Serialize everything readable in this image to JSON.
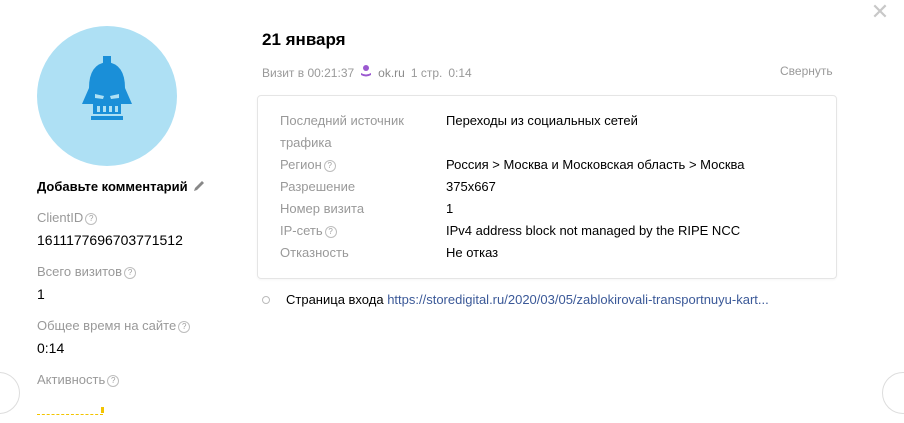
{
  "close": {
    "icon": "close-icon"
  },
  "sidebar": {
    "avatar_icon": "user-mask-icon",
    "comment_label": "Добавьте комментарий",
    "edit_icon": "pencil-icon",
    "client_id_label": "ClientID",
    "client_id_value": "1611177696703771512",
    "total_visits_label": "Всего визитов",
    "total_visits_value": "1",
    "total_time_label": "Общее время на сайте",
    "total_time_value": "0:14",
    "activity_label": "Активность",
    "help_glyph": "?"
  },
  "visit": {
    "date": "21 января",
    "time_text": "Визит в 00:21:37",
    "source_icon": "odnoklassniki-icon",
    "source_color": "#9b59d0",
    "source_name": "ok.ru",
    "pages": "1 стр.",
    "duration": "0:14",
    "collapse_label": "Свернуть"
  },
  "details": [
    {
      "label": "Последний источник трафика",
      "value": "Переходы из социальных сетей",
      "help": false
    },
    {
      "label": "Регион",
      "value": "Россия > Москва и Московская область > Москва",
      "help": true
    },
    {
      "label": "Разрешение",
      "value": "375x667",
      "help": false
    },
    {
      "label": "Номер визита",
      "value": "1",
      "help": false
    },
    {
      "label": "IP-сеть",
      "value": "IPv4 address block not managed by the RIPE NCC",
      "help": true
    },
    {
      "label": "Отказность",
      "value": "Не отказ",
      "help": false
    }
  ],
  "entry_page": {
    "label": "Страница входа",
    "url": "https://storedigital.ru/2020/03/05/zablokirovali-transportnuyu-kart..."
  },
  "colors": {
    "avatar_bg": "#aee0f4",
    "avatar_icon": "#1a8fd8",
    "activity": "#f3c400",
    "link": "#3b5998"
  }
}
